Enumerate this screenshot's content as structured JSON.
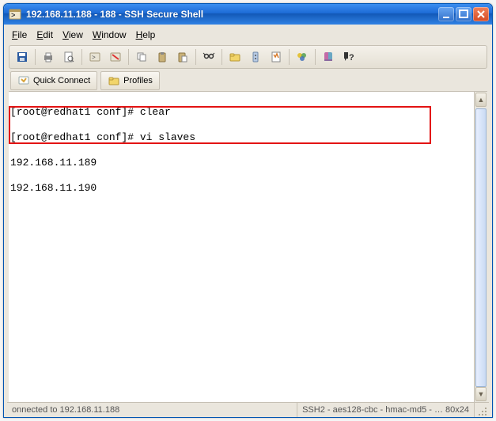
{
  "title": "192.168.11.188 - 188 - SSH Secure Shell",
  "menus": {
    "file": "File",
    "edit": "Edit",
    "view": "View",
    "window": "Window",
    "help": "Help"
  },
  "profilebar": {
    "quick_connect": "Quick Connect",
    "profiles": "Profiles"
  },
  "terminal": {
    "line1_prompt": "[root@redhat1 conf]# ",
    "line1_cmd": "clear",
    "line2_prompt": "[root@redhat1 conf]# ",
    "line2_cmd": "vi slaves",
    "line3": "192.168.11.189",
    "line4": "192.168.11.190"
  },
  "status": {
    "left": "onnected to 192.168.11.188",
    "right": "SSH2 - aes128-cbc - hmac-md5 - … 80x24"
  },
  "icons": {
    "app": "terminal-icon",
    "minimize": "_",
    "maximize": "□",
    "close": "×",
    "arrow_up": "▲",
    "arrow_down": "▼"
  }
}
